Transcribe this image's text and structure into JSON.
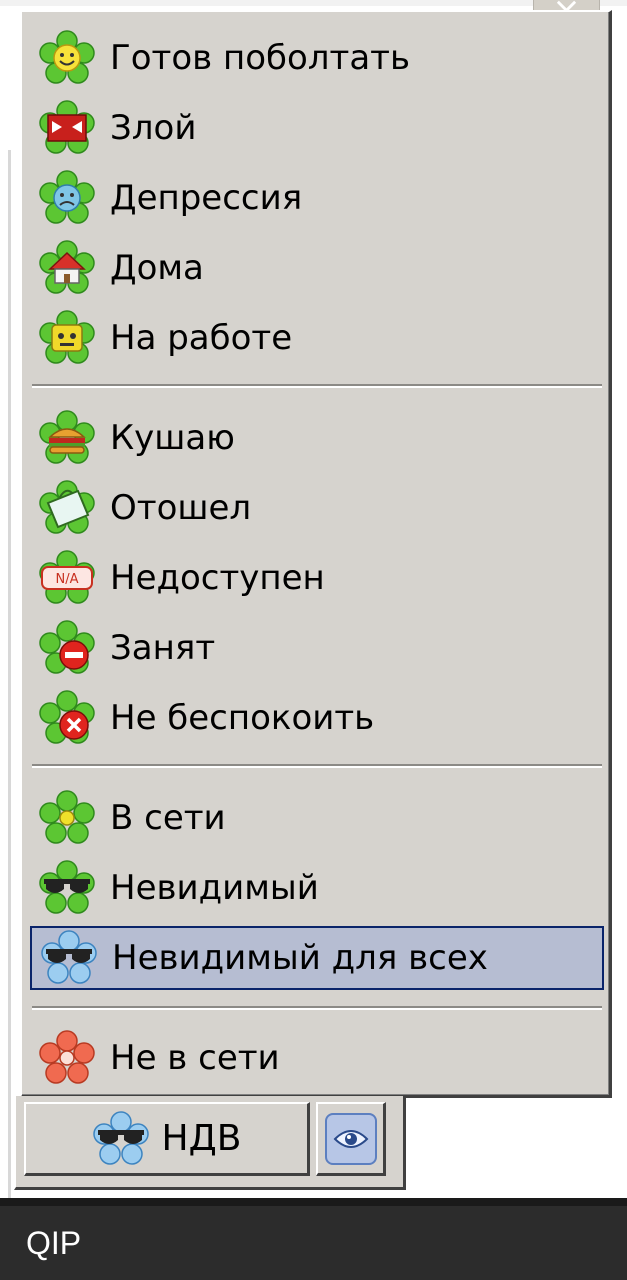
{
  "window": {
    "close_glyph": "×"
  },
  "menu": {
    "items": [
      {
        "label": "Готов поболтать",
        "icon": "smile-flower-icon"
      },
      {
        "label": "Злой",
        "icon": "angry-flower-icon"
      },
      {
        "label": "Депрессия",
        "icon": "sad-flower-icon"
      },
      {
        "label": "Дома",
        "icon": "house-flower-icon"
      },
      {
        "label": "На работе",
        "icon": "work-flower-icon"
      },
      {
        "label": "Кушаю",
        "icon": "burger-flower-icon"
      },
      {
        "label": "Отошел",
        "icon": "away-flower-icon"
      },
      {
        "label": "Недоступен",
        "icon": "na-flower-icon"
      },
      {
        "label": "Занят",
        "icon": "busy-flower-icon"
      },
      {
        "label": "Не беспокоить",
        "icon": "dnd-flower-icon"
      },
      {
        "label": "В сети",
        "icon": "online-flower-icon"
      },
      {
        "label": "Невидимый",
        "icon": "invisible-flower-icon"
      },
      {
        "label": "Невидимый для всех",
        "icon": "invisible-all-flower-icon",
        "selected": true
      },
      {
        "label": "Не в сети",
        "icon": "offline-flower-icon"
      }
    ]
  },
  "status_button": {
    "label": "НДВ",
    "icon": "invisible-all-flower-icon"
  },
  "eye_button": {
    "icon": "eye-icon"
  },
  "app": {
    "name": "QIP"
  },
  "colors": {
    "menu_bg": "#d6d3ce",
    "selection_bg": "#b6bdd2",
    "selection_border": "#0a246a",
    "flower_green": "#5cc633",
    "flower_red": "#f06a50",
    "flower_blue": "#7ab7e6",
    "strip_bg": "#2c2c2c"
  }
}
